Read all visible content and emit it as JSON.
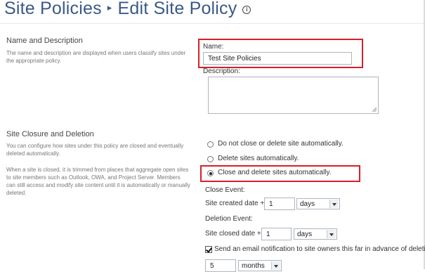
{
  "header": {
    "breadcrumb_root": "Site Policies",
    "separator": "▸",
    "page_title": "Edit Site Policy",
    "info_glyph": "i"
  },
  "name_section": {
    "heading": "Name and Description",
    "description": "The name and description are displayed when users classify sites under the appropriate policy.",
    "name_label": "Name:",
    "name_value": "Test Site Policies",
    "description_label": "Description:",
    "description_value": ""
  },
  "closure_section": {
    "heading": "Site Closure and Deletion",
    "description_1": "You can configure how sites under this policy are closed and eventually deleted automatically.",
    "description_2": "When a site is closed, it is trimmed from places that aggregate open sites to site members such as Outlook, OWA, and Project Server. Members can still access and modify site content until it is automatically or manually deleted.",
    "options": [
      {
        "label": "Do not close or delete site automatically.",
        "selected": false
      },
      {
        "label": "Delete sites automatically.",
        "selected": false
      },
      {
        "label": "Close and delete sites automatically.",
        "selected": true
      }
    ],
    "close_event_label": "Close Event:",
    "close_trigger_label": "Site created date +",
    "close_amount": "1",
    "close_unit": "days",
    "deletion_event_label": "Deletion Event:",
    "deletion_trigger_label": "Site closed date +",
    "deletion_amount": "1",
    "deletion_unit": "days",
    "notify_checked": true,
    "notify_label": "Send an email notification to site owners this far in advance of deletion:",
    "notify_amount": "5",
    "notify_unit": "months"
  },
  "colors": {
    "title": "#3a5a88",
    "highlight_border": "#d62027"
  }
}
